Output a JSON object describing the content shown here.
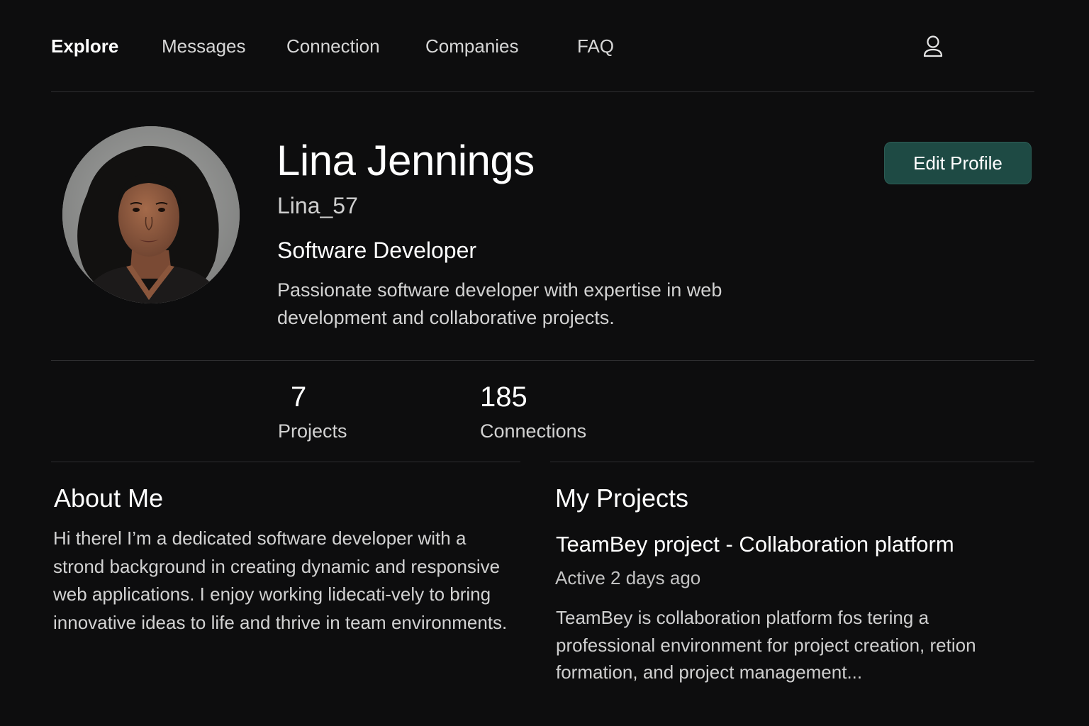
{
  "nav": {
    "items": [
      {
        "label": "Explore",
        "active": true
      },
      {
        "label": "Messages",
        "active": false
      },
      {
        "label": "Connection",
        "active": false
      },
      {
        "label": "Companies",
        "active": false
      },
      {
        "label": "FAQ",
        "active": false
      }
    ],
    "user_icon": "user-icon"
  },
  "profile": {
    "name": "Lina Jennings",
    "username": "Lina_57",
    "role": "Software Developer",
    "bio": "Passionate software developer with expertise in web development and collaborative projects.",
    "edit_button": "Edit Profile"
  },
  "stats": {
    "projects": {
      "value": "7",
      "label": "Projects"
    },
    "connections": {
      "value": "185",
      "label": "Connections"
    }
  },
  "about": {
    "title": "About Me",
    "text": "Hi therel I’m a dedicated software developer with a strond background in creating dynamic and responsive web applications. I enjoy working lidecati-vely to bring innovative ideas to life and thrive in team environments."
  },
  "projects": {
    "title": "My Projects",
    "items": [
      {
        "title": "TeamBey project - Collaboration platform",
        "status": "Active 2 days ago",
        "description": "TeamBey is collaboration platform fos tering a professional environment for project creation, retion formation, and project management..."
      }
    ]
  },
  "colors": {
    "background": "#0d0d0e",
    "accent": "#1e4a44",
    "divider": "#2e2e30"
  }
}
